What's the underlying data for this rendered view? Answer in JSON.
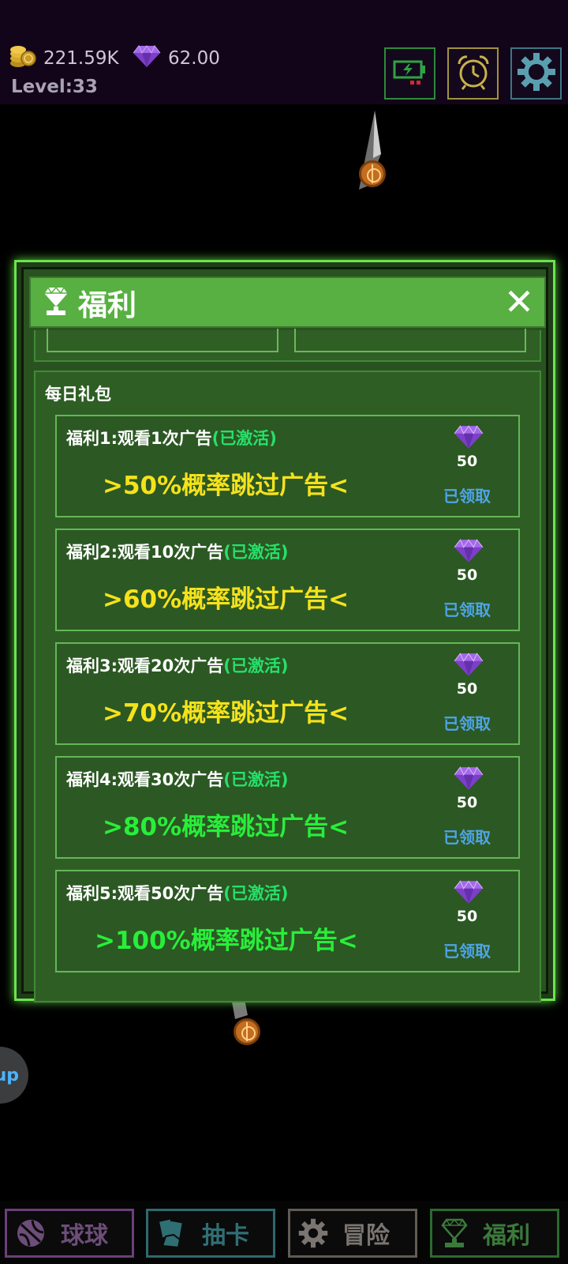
{
  "hud": {
    "coins": "221.59K",
    "gems": "62.00",
    "level": "Level:33",
    "coin_icon": "coin-stack-icon",
    "gem_icon": "purple-diamond-icon",
    "buttons": [
      "battery-icon",
      "alarm-clock-icon",
      "gear-icon"
    ]
  },
  "background": {
    "up_button_label": "up"
  },
  "dialog": {
    "title": "福利",
    "close": "✕",
    "section_title": "每日礼包",
    "cards": [
      {
        "title": "福利1:观看1次广告",
        "status": "(已激活)",
        "desc": ">50%概率跳过广告<",
        "desc_color": "#f5e21b",
        "amount": "50",
        "claim": "已领取"
      },
      {
        "title": "福利2:观看10次广告",
        "status": "(已激活)",
        "desc": ">60%概率跳过广告<",
        "desc_color": "#f5e21b",
        "amount": "50",
        "claim": "已领取"
      },
      {
        "title": "福利3:观看20次广告",
        "status": "(已激活)",
        "desc": ">70%概率跳过广告<",
        "desc_color": "#f5e21b",
        "amount": "50",
        "claim": "已领取"
      },
      {
        "title": "福利4:观看30次广告",
        "status": "(已激活)",
        "desc": ">80%概率跳过广告<",
        "desc_color": "#28ee3a",
        "amount": "50",
        "claim": "已领取"
      },
      {
        "title": "福利5:观看50次广告",
        "status": "(已激活)",
        "desc": ">100%概率跳过广告<",
        "desc_color": "#28ee3a",
        "amount": "50",
        "claim": "已领取"
      }
    ]
  },
  "nav": {
    "ball": "球球",
    "card": "抽卡",
    "adventure": "冒险",
    "fuli": "福利"
  },
  "colors": {
    "accent_green": "#57b041",
    "status_green": "#26e06a",
    "claim_blue": "#4ea4e8",
    "gem_purple": "#8e4fd6"
  }
}
